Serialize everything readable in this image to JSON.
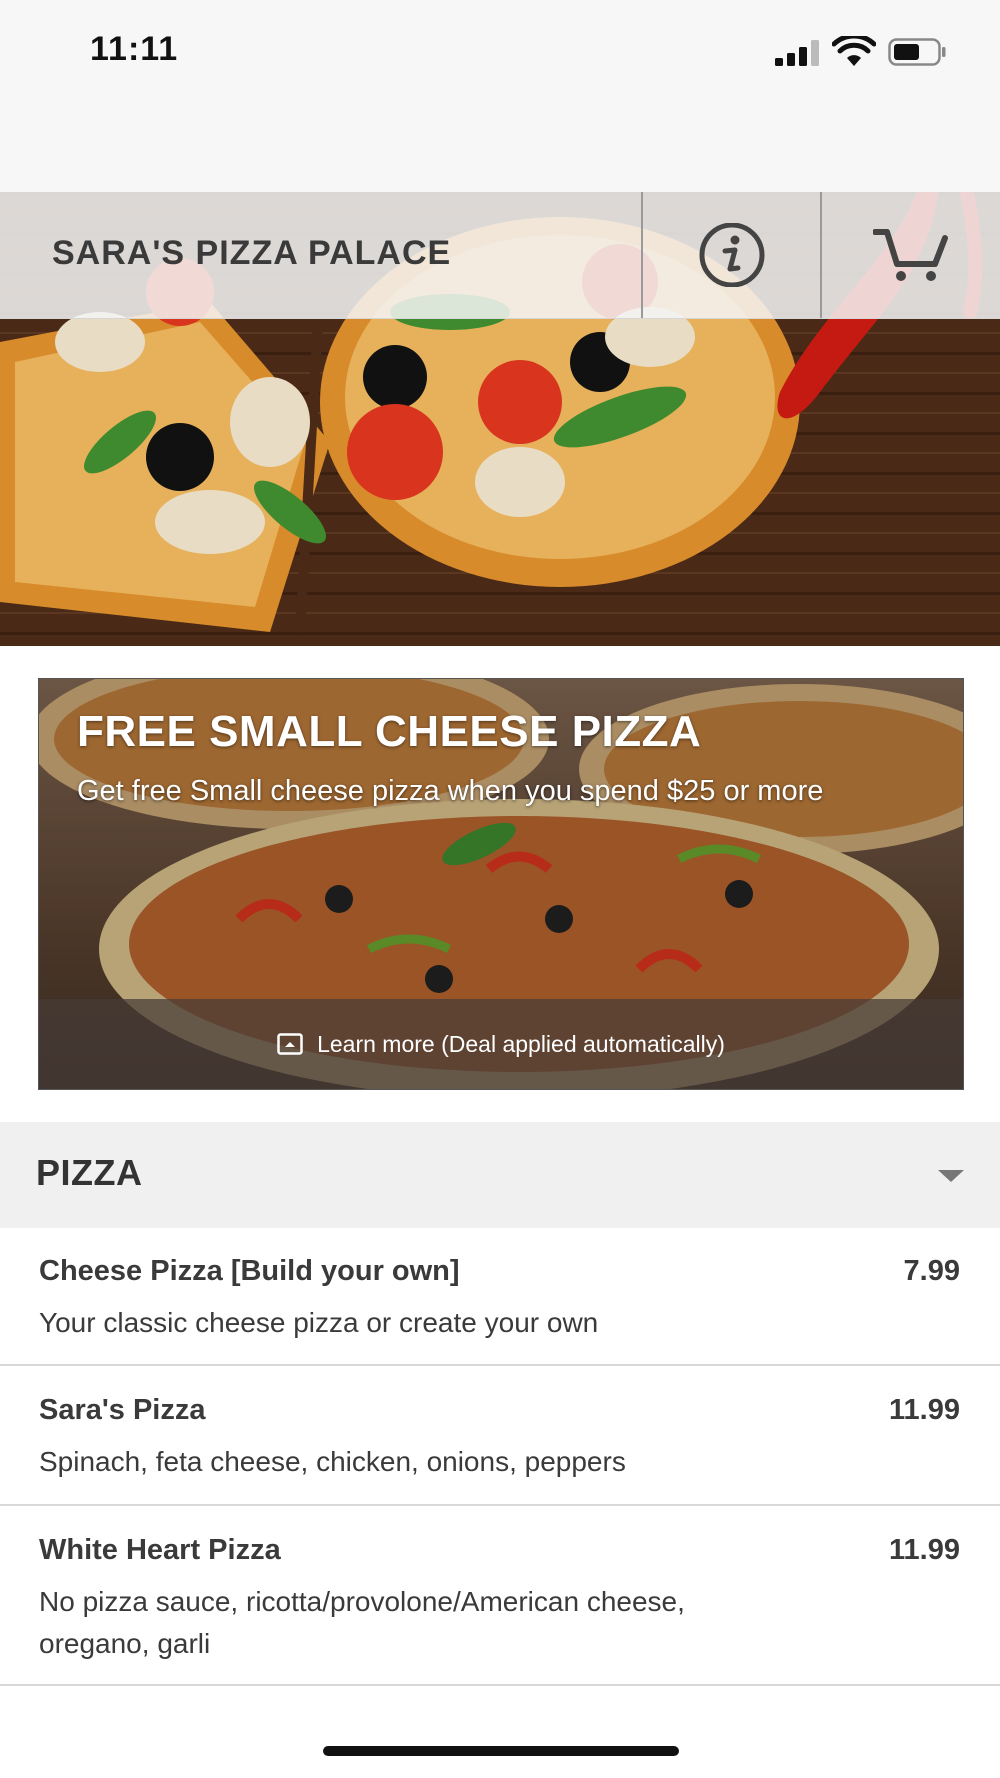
{
  "status_bar": {
    "time": "11:11"
  },
  "header": {
    "brand": "SARA'S PIZZA PALACE",
    "info_icon": "info-icon",
    "cart_icon": "cart-icon"
  },
  "promo": {
    "title": "FREE SMALL CHEESE PIZZA",
    "subtitle": "Get free Small cheese pizza when you spend $25 or more",
    "link": "Learn more (Deal applied automatically)",
    "link_icon": "expand-icon"
  },
  "menu": {
    "section": "PIZZA",
    "items": [
      {
        "name": "Cheese Pizza [Build your own]",
        "price": "7.99",
        "description": "Your classic cheese pizza or create your own"
      },
      {
        "name": "Sara's Pizza",
        "price": "11.99",
        "description": "Spinach, feta cheese, chicken, onions, peppers"
      },
      {
        "name": "White Heart Pizza",
        "price": "11.99",
        "description": "No pizza sauce, ricotta/provolone/American cheese, oregano, garli"
      }
    ]
  },
  "colors": {
    "header_bg": "#f5f5f5",
    "text": "#333333",
    "section_bg": "#f0f0f0",
    "wood": "#4a2a17"
  }
}
